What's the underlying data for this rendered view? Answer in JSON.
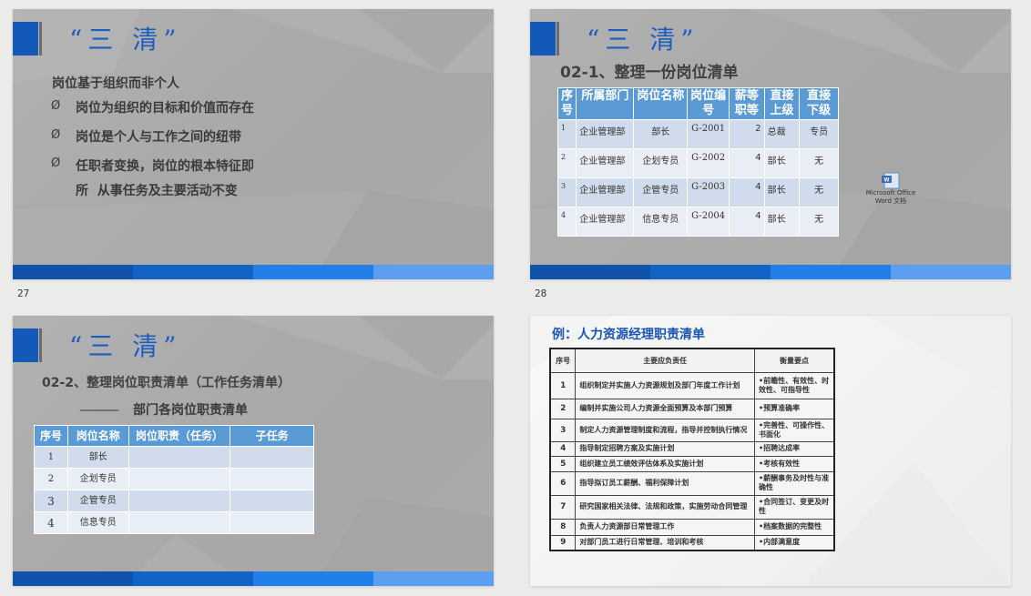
{
  "slides": [
    {
      "number": "27",
      "title": "“三 清”",
      "heading": "岗位基于组织而非个人",
      "bullet_symbol": "Ø",
      "bullets": [
        "岗位为组织的目标和价值而存在",
        "岗位是个人与工作之间的纽带",
        "任职者变换，岗位的根本特征即"
      ],
      "continuation": "所  从事任务及主要活动不变"
    },
    {
      "number": "28",
      "title": "“三 清”",
      "subtitle": "02-1、整理一份岗位清单",
      "table": {
        "headers": [
          "序号",
          "所属部门",
          "岗位名称",
          "岗位编号",
          "薪等职等",
          "直接上级",
          "直接下级"
        ],
        "rows": [
          [
            "1",
            "企业管理部",
            "部长",
            "G-2001",
            "2",
            "总裁",
            "专员"
          ],
          [
            "2",
            "企业管理部",
            "企划专员",
            "G-2002",
            "4",
            "部长",
            "无"
          ],
          [
            "3",
            "企业管理部",
            "企管专员",
            "G-2003",
            "4",
            "部长",
            "无"
          ],
          [
            "4",
            "企业管理部",
            "信息专员",
            "G-2004",
            "4",
            "部长",
            "无"
          ]
        ]
      },
      "embedded_object": {
        "icon": "word-document-icon",
        "label_line1": "Microsoft Office",
        "label_line2": "Word 文档"
      }
    },
    {
      "title": "“三 清”",
      "subtitle": "02-2、整理岗位职责清单（工作任务清单）",
      "blank": "______",
      "subheading": "部门各岗位职责清单",
      "table": {
        "headers": [
          "序号",
          "岗位名称",
          "岗位职责（任务）",
          "子任务"
        ],
        "rows": [
          [
            "1",
            "部长",
            "",
            ""
          ],
          [
            "2",
            "企划专员",
            "",
            ""
          ],
          [
            "3",
            "企管专员",
            "",
            ""
          ],
          [
            "4",
            "信息专员",
            "",
            ""
          ]
        ]
      }
    },
    {
      "title": "例：人力资源经理职责清单",
      "table": {
        "headers": [
          "序号",
          "主要应负责任",
          "衡量要点"
        ],
        "rows": [
          [
            "1",
            "组织制定并实施人力资源规划及部门年度工作计划",
            "•前瞻性、有效性、时效性、可指导性"
          ],
          [
            "2",
            "编制并实施公司人力资源全面预算及本部门预算",
            "•预算准确率"
          ],
          [
            "3",
            "制定人力资源管理制度和流程，指导并控制执行情况",
            "•完善性、可操作性、书面化"
          ],
          [
            "4",
            "指导制定招聘方案及实施计划",
            "•招聘达成率"
          ],
          [
            "5",
            "组织建立员工绩效评估体系及实施计划",
            "•考核有效性"
          ],
          [
            "6",
            "指导拟订员工薪酬、福利保障计划",
            "•薪酬事务及时性与准确性"
          ],
          [
            "7",
            "研究国家相关法律、法规和政策，实施劳动合同管理",
            "•合同签订、变更及时性"
          ],
          [
            "8",
            "负责人力资源部日常管理工作",
            "•档案数据的完整性"
          ],
          [
            "9",
            "对部门员工进行日常管理、培训和考核",
            "•内部满意度"
          ]
        ]
      }
    }
  ],
  "colors": {
    "accent_blue": "#1259b8",
    "title_blue": "#1d5cc0",
    "bar": [
      "#1153aa",
      "#1263c6",
      "#227ee9",
      "#5c9ff0"
    ],
    "table_header": "#5b9bd5"
  }
}
